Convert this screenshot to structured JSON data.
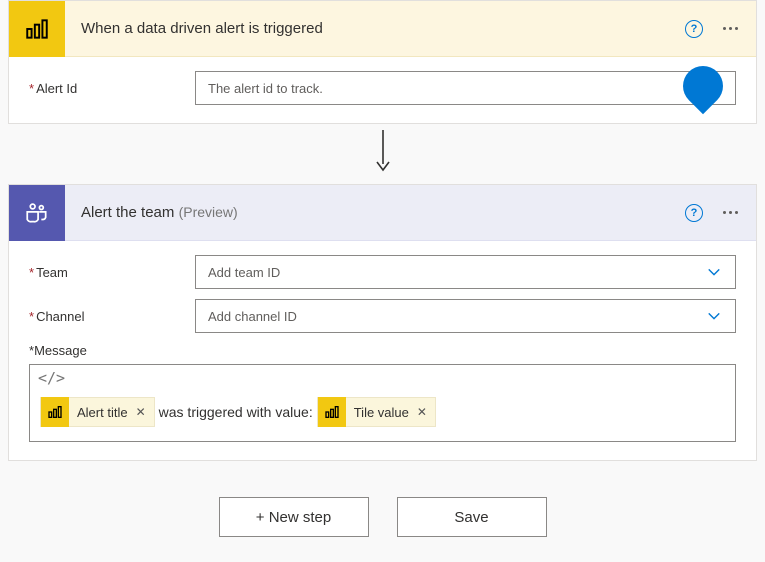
{
  "trigger": {
    "title": "When a data driven alert is triggered",
    "fields": {
      "alert_id": {
        "label": "Alert Id",
        "placeholder": "The alert id to track."
      }
    }
  },
  "action": {
    "title": "Alert the team",
    "preview": "(Preview)",
    "fields": {
      "team": {
        "label": "Team",
        "placeholder": "Add team ID"
      },
      "channel": {
        "label": "Channel",
        "placeholder": "Add channel ID"
      },
      "message": {
        "label": "Message",
        "tokens": {
          "title": "Alert title",
          "between_text": "was triggered with value:",
          "value": "Tile value"
        }
      }
    }
  },
  "buttons": {
    "new_step": "+ New step",
    "save": "Save"
  }
}
